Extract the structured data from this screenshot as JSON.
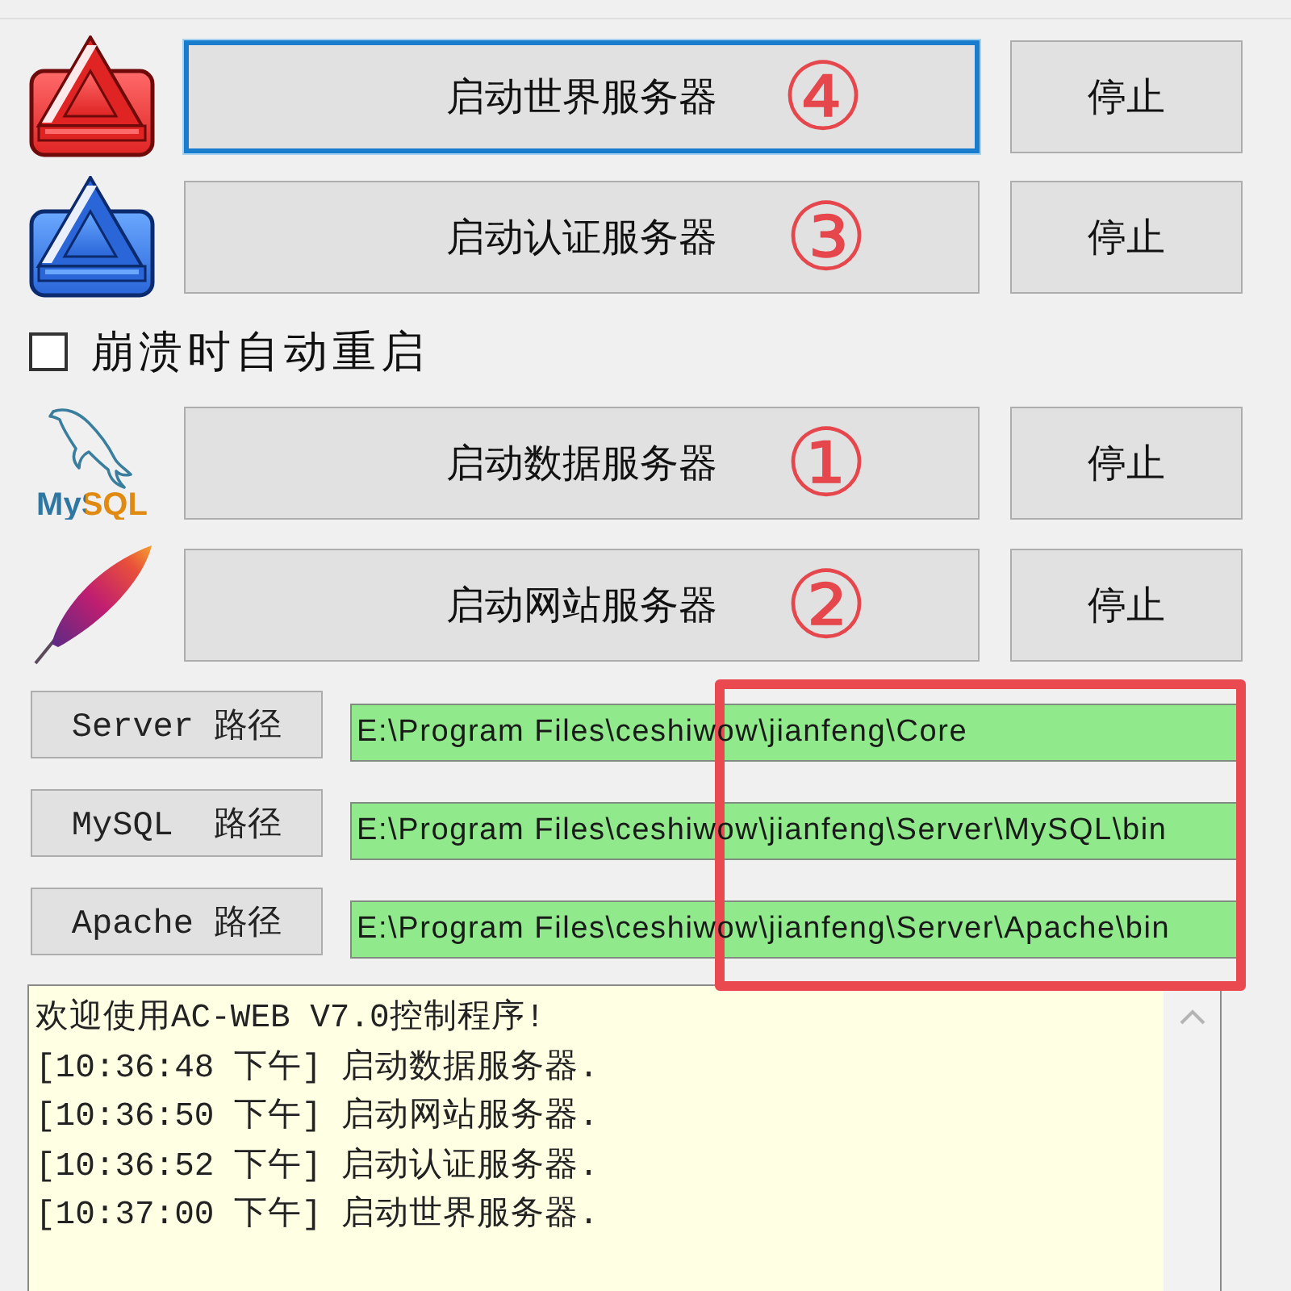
{
  "game_servers": [
    {
      "kind": "world",
      "label": "启动世界服务器",
      "step": "④",
      "stop_label": "停止",
      "focused": true
    },
    {
      "kind": "auth",
      "label": "启动认证服务器",
      "step": "③",
      "stop_label": "停止",
      "focused": false
    }
  ],
  "auto_restart": {
    "label": "崩溃时自动重启",
    "checked": false
  },
  "support_servers": [
    {
      "kind": "database",
      "logo_text": "MySQL",
      "label": "启动数据服务器",
      "step": "①",
      "stop_label": "停止",
      "focused": false
    },
    {
      "kind": "web",
      "label": "启动网站服务器",
      "step": "②",
      "stop_label": "停止",
      "focused": false
    }
  ],
  "paths": [
    {
      "label": "Server 路径",
      "value": "E:\\Program Files\\ceshiwow\\jianfeng\\Core"
    },
    {
      "label": "MySQL  路径",
      "value": "E:\\Program Files\\ceshiwow\\jianfeng\\Server\\MySQL\\bin"
    },
    {
      "label": "Apache 路径",
      "value": "E:\\Program Files\\ceshiwow\\jianfeng\\Server\\Apache\\bin"
    }
  ],
  "log": {
    "lines": [
      "欢迎使用AC-WEB V7.0控制程序!",
      "[10:36:48 下午] 启动数据服务器.",
      "[10:36:50 下午] 启动网站服务器.",
      "[10:36:52 下午] 启动认证服务器.",
      "[10:37:00 下午] 启动世界服务器."
    ]
  }
}
